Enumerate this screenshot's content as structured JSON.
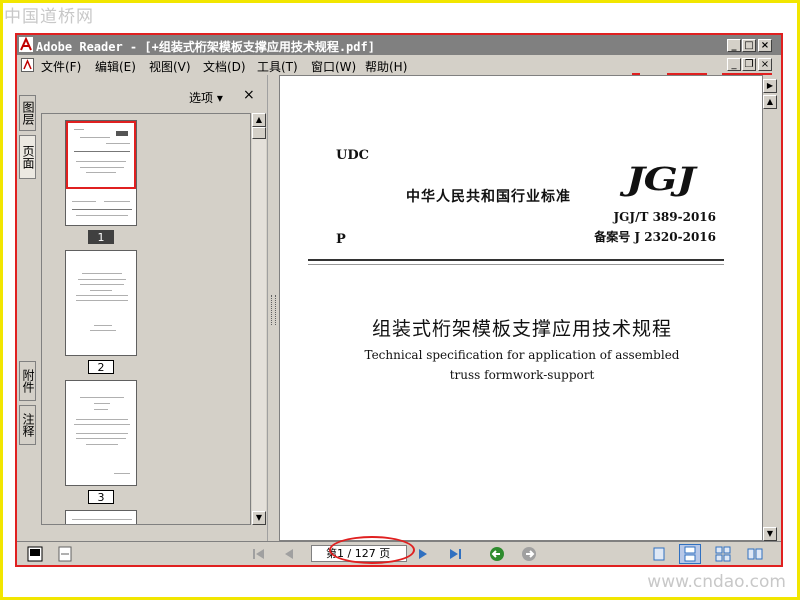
{
  "watermark": {
    "top": "中国道桥网",
    "bottom": "www.cndao.com"
  },
  "window": {
    "title": "Adobe Reader - [+组装式桁架模板支撑应用技术规程.pdf]",
    "controls": {
      "minimize": "_",
      "maximize": "□",
      "close": "×",
      "restore": "❐"
    }
  },
  "menu": [
    "文件(F)",
    "编辑(E)",
    "视图(V)",
    "文档(D)",
    "工具(T)",
    "窗口(W)",
    "帮助(H)"
  ],
  "side_tabs": {
    "layers": "图层",
    "pages": "页面",
    "attachments": "附件",
    "comments": "注释"
  },
  "thumbnails_panel": {
    "options_label": "选项 ▾",
    "close_label": "×",
    "pages": [
      {
        "label": "1",
        "selected": true
      },
      {
        "label": "2",
        "selected": false
      },
      {
        "label": "3",
        "selected": false
      }
    ]
  },
  "document": {
    "udc": "UDC",
    "standard_name": "中华人民共和国行业标准",
    "logo": "JGJ",
    "code": "JGJ/T 389-2016",
    "record": "备案号 J 2320-2016",
    "p_label": "P",
    "title_cn": "组装式桁架模板支撑应用技术规程",
    "title_en_line1": "Technical specification for application of assembled",
    "title_en_line2": "truss formwork-support"
  },
  "navigation": {
    "page_prefix": "第",
    "page_value": "1 / 127 页",
    "current_page": 1,
    "total_pages": 127
  },
  "colors": {
    "annotation_red": "#e02020",
    "frame_yellow": "#f2e600",
    "title_bar": "#808080",
    "chrome": "#d4d0c8"
  }
}
